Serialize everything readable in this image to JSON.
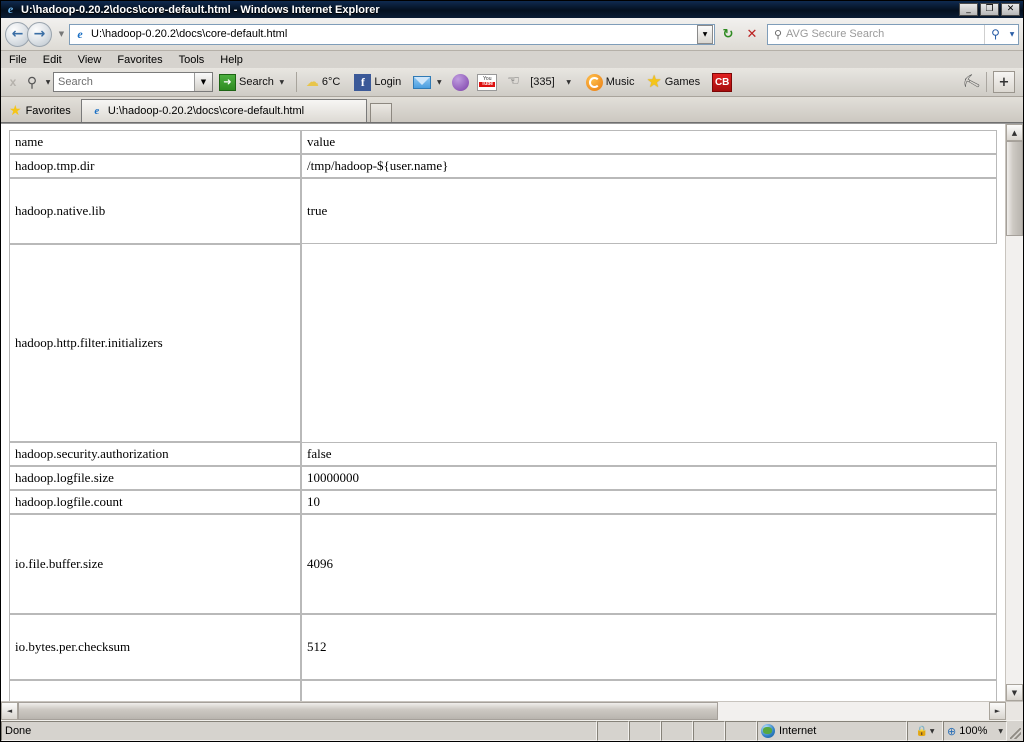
{
  "window": {
    "title": "U:\\hadoop-0.20.2\\docs\\core-default.html - Windows Internet Explorer",
    "minimize_label": "_",
    "maximize_label": "❐",
    "close_label": "✕"
  },
  "nav": {
    "back_label": "←",
    "forward_label": "→",
    "history_caret": "▼",
    "address_value": "U:\\hadoop-0.20.2\\docs\\core-default.html",
    "address_caret": "▼",
    "refresh_label": "↻",
    "stop_label": "✕",
    "search_placeholder": "AVG Secure Search",
    "search_icon": "⚲",
    "go_icon": "⚲",
    "go_caret": "▼"
  },
  "menu": {
    "items": [
      {
        "label": "File",
        "accel": "F"
      },
      {
        "label": "Edit",
        "accel": "E"
      },
      {
        "label": "View",
        "accel": "V"
      },
      {
        "label": "Favorites",
        "accel": "a"
      },
      {
        "label": "Tools",
        "accel": "T"
      },
      {
        "label": "Help",
        "accel": "H"
      }
    ]
  },
  "avg_toolbar": {
    "close_label": "x",
    "logo_icon": "⚲",
    "logo_caret": "▼",
    "search_placeholder": "Search",
    "search_value": "",
    "dropdown_caret": "▼",
    "search_button_label": "Search",
    "search_button_icon": "➜",
    "search_button_caret": "▼",
    "weather_label": "6°C",
    "facebook_label": "Login",
    "facebook_icon": "f",
    "mail_caret": "▼",
    "notifications_label": "[335]",
    "notifications_caret": "▼",
    "music_label": "Music",
    "games_label": "Games",
    "games_icon": "★",
    "cb_label": "CB",
    "youtube_top": "You",
    "youtube_bottom": "Tube",
    "wrench_icon": "⛏",
    "plus_label": "+"
  },
  "favbar": {
    "favorites_label": "Favorites",
    "star_icon": "★"
  },
  "tabs": {
    "items": [
      {
        "label": "U:\\hadoop-0.20.2\\docs\\core-default.html",
        "active": true
      }
    ],
    "new_tab_label": ""
  },
  "page_table": {
    "columns": [
      "name",
      "value"
    ],
    "rows": [
      {
        "name": "name",
        "value": "value",
        "size": "normal"
      },
      {
        "name": "hadoop.tmp.dir",
        "value": "/tmp/hadoop-${user.name}",
        "size": "normal"
      },
      {
        "name": "hadoop.native.lib",
        "value": "true",
        "size": "big"
      },
      {
        "name": "hadoop.http.filter.initializers",
        "value": "",
        "size": "tall"
      },
      {
        "name": "hadoop.security.authorization",
        "value": "false",
        "size": "normal"
      },
      {
        "name": "hadoop.logfile.size",
        "value": "10000000",
        "size": "normal"
      },
      {
        "name": "hadoop.logfile.count",
        "value": "10",
        "size": "normal"
      },
      {
        "name": "io.file.buffer.size",
        "value": "4096",
        "size": "mid"
      },
      {
        "name": "io.bytes.per.checksum",
        "value": "512",
        "size": "big"
      },
      {
        "name": "",
        "value": "",
        "size": "part"
      }
    ]
  },
  "scrollbars": {
    "up_arrow": "▲",
    "down_arrow": "▼",
    "left_arrow": "◄",
    "right_arrow": "►"
  },
  "statusbar": {
    "status_text": "Done",
    "zone_label": "Internet",
    "lock_icon": "🔒",
    "lock_caret": "▼",
    "zoom_icon": "⊕",
    "zoom_level": "100%",
    "zoom_caret": "▼"
  },
  "colors": {
    "titlebar": "#0a1c34",
    "chrome": "#d6d3ce",
    "page_background": "#ffffff",
    "table_border": "#b9b9b9",
    "accent_blue": "#1a6fc4"
  }
}
